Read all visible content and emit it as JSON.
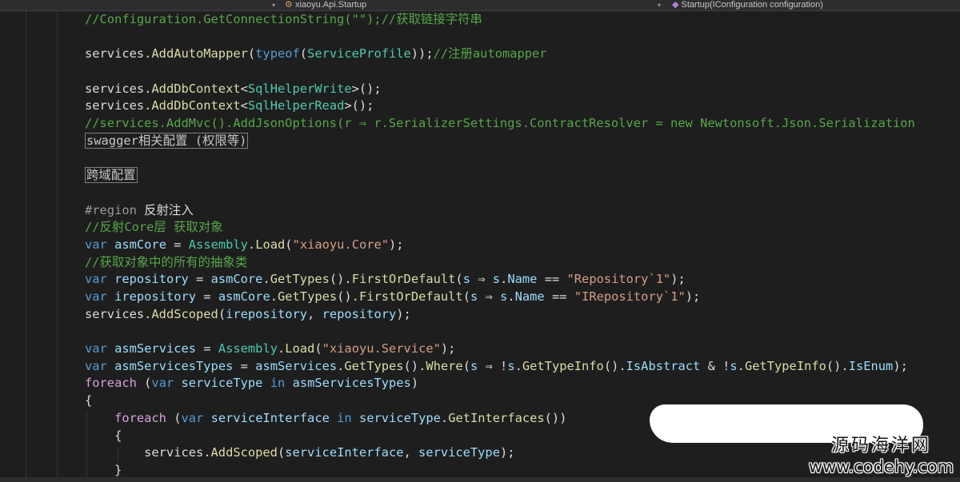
{
  "toolbar": {
    "project_dropdown": "xiaoyu.Api.Startup",
    "member_dropdown": "Startup(IConfiguration configuration)",
    "class_icon": "class-icon",
    "method_icon": "method-icon"
  },
  "code_lines": [
    [
      [
        "comment",
        "//Configuration.GetConnectionString(\"\");//获取链接字符串"
      ]
    ],
    [],
    [
      [
        "plain",
        "services."
      ],
      [
        "method",
        "AddAutoMapper"
      ],
      [
        "plain",
        "("
      ],
      [
        "keyword",
        "typeof"
      ],
      [
        "plain",
        "("
      ],
      [
        "type",
        "ServiceProfile"
      ],
      [
        "plain",
        "));"
      ],
      [
        "comment",
        "//注册automapper"
      ]
    ],
    [],
    [
      [
        "plain",
        "services."
      ],
      [
        "method",
        "AddDbContext"
      ],
      [
        "plain",
        "<"
      ],
      [
        "type",
        "SqlHelperWrite"
      ],
      [
        "plain",
        ">();"
      ]
    ],
    [
      [
        "plain",
        "services."
      ],
      [
        "method",
        "AddDbContext"
      ],
      [
        "plain",
        "<"
      ],
      [
        "type",
        "SqlHelperRead"
      ],
      [
        "plain",
        ">();"
      ]
    ],
    [
      [
        "comment",
        "//services.AddMvc().AddJsonOptions(r ⇒ r.SerializerSettings.ContractResolver = new Newtonsoft.Json.Serialization"
      ]
    ],
    [
      [
        "collapsed",
        "swagger相关配置 (权限等)"
      ]
    ],
    [],
    [
      [
        "collapsed",
        "跨域配置"
      ]
    ],
    [],
    [
      [
        "region",
        "#region "
      ],
      [
        "regionname",
        "反射注入"
      ]
    ],
    [
      [
        "comment",
        "//反射Core层 获取对象"
      ]
    ],
    [
      [
        "keyword",
        "var"
      ],
      [
        "plain",
        " "
      ],
      [
        "variable",
        "asmCore"
      ],
      [
        "plain",
        " = "
      ],
      [
        "type",
        "Assembly"
      ],
      [
        "plain",
        "."
      ],
      [
        "method",
        "Load"
      ],
      [
        "plain",
        "("
      ],
      [
        "string",
        "\"xiaoyu.Core\""
      ],
      [
        "plain",
        ");"
      ]
    ],
    [
      [
        "comment",
        "//获取对象中的所有的抽象类"
      ]
    ],
    [
      [
        "keyword",
        "var"
      ],
      [
        "plain",
        " "
      ],
      [
        "variable",
        "repository"
      ],
      [
        "plain",
        " = "
      ],
      [
        "variable",
        "asmCore"
      ],
      [
        "plain",
        "."
      ],
      [
        "method",
        "GetTypes"
      ],
      [
        "plain",
        "()."
      ],
      [
        "method",
        "FirstOrDefault"
      ],
      [
        "plain",
        "("
      ],
      [
        "variable",
        "s"
      ],
      [
        "plain",
        " ⇒ "
      ],
      [
        "variable",
        "s"
      ],
      [
        "plain",
        "."
      ],
      [
        "variable",
        "Name"
      ],
      [
        "plain",
        " == "
      ],
      [
        "string",
        "\"Repository`1\""
      ],
      [
        "plain",
        ");"
      ]
    ],
    [
      [
        "keyword",
        "var"
      ],
      [
        "plain",
        " "
      ],
      [
        "variable",
        "irepository"
      ],
      [
        "plain",
        " = "
      ],
      [
        "variable",
        "asmCore"
      ],
      [
        "plain",
        "."
      ],
      [
        "method",
        "GetTypes"
      ],
      [
        "plain",
        "()."
      ],
      [
        "method",
        "FirstOrDefault"
      ],
      [
        "plain",
        "("
      ],
      [
        "variable",
        "s"
      ],
      [
        "plain",
        " ⇒ "
      ],
      [
        "variable",
        "s"
      ],
      [
        "plain",
        "."
      ],
      [
        "variable",
        "Name"
      ],
      [
        "plain",
        " == "
      ],
      [
        "string",
        "\"IRepository`1\""
      ],
      [
        "plain",
        ");"
      ]
    ],
    [
      [
        "plain",
        "services."
      ],
      [
        "method",
        "AddScoped"
      ],
      [
        "plain",
        "("
      ],
      [
        "variable",
        "irepository"
      ],
      [
        "plain",
        ", "
      ],
      [
        "variable",
        "repository"
      ],
      [
        "plain",
        ");"
      ]
    ],
    [],
    [
      [
        "keyword",
        "var"
      ],
      [
        "plain",
        " "
      ],
      [
        "variable",
        "asmServices"
      ],
      [
        "plain",
        " = "
      ],
      [
        "type",
        "Assembly"
      ],
      [
        "plain",
        "."
      ],
      [
        "method",
        "Load"
      ],
      [
        "plain",
        "("
      ],
      [
        "string",
        "\"xiaoyu.Service\""
      ],
      [
        "plain",
        ");"
      ]
    ],
    [
      [
        "keyword",
        "var"
      ],
      [
        "plain",
        " "
      ],
      [
        "variable",
        "asmServicesTypes"
      ],
      [
        "plain",
        " = "
      ],
      [
        "variable",
        "asmServices"
      ],
      [
        "plain",
        "."
      ],
      [
        "method",
        "GetTypes"
      ],
      [
        "plain",
        "()."
      ],
      [
        "method",
        "Where"
      ],
      [
        "plain",
        "("
      ],
      [
        "variable",
        "s"
      ],
      [
        "plain",
        " ⇒ !"
      ],
      [
        "variable",
        "s"
      ],
      [
        "plain",
        "."
      ],
      [
        "method",
        "GetTypeInfo"
      ],
      [
        "plain",
        "()."
      ],
      [
        "variable",
        "IsAbstract"
      ],
      [
        "plain",
        " & !"
      ],
      [
        "variable",
        "s"
      ],
      [
        "plain",
        "."
      ],
      [
        "method",
        "GetTypeInfo"
      ],
      [
        "plain",
        "()."
      ],
      [
        "variable",
        "IsEnum"
      ],
      [
        "plain",
        ");"
      ]
    ],
    [
      [
        "control",
        "foreach"
      ],
      [
        "plain",
        " ("
      ],
      [
        "keyword",
        "var"
      ],
      [
        "plain",
        " "
      ],
      [
        "variable",
        "serviceType"
      ],
      [
        "plain",
        " "
      ],
      [
        "keyword",
        "in"
      ],
      [
        "plain",
        " "
      ],
      [
        "variable",
        "asmServicesTypes"
      ],
      [
        "plain",
        ")"
      ]
    ],
    [
      [
        "plain",
        "{"
      ]
    ],
    [
      [
        "plain",
        "    "
      ],
      [
        "control",
        "foreach"
      ],
      [
        "plain",
        " ("
      ],
      [
        "keyword",
        "var"
      ],
      [
        "plain",
        " "
      ],
      [
        "variable",
        "serviceInterface"
      ],
      [
        "plain",
        " "
      ],
      [
        "keyword",
        "in"
      ],
      [
        "plain",
        " "
      ],
      [
        "variable",
        "serviceType"
      ],
      [
        "plain",
        "."
      ],
      [
        "method",
        "GetInterfaces"
      ],
      [
        "plain",
        "())"
      ]
    ],
    [
      [
        "plain",
        "    {"
      ]
    ],
    [
      [
        "plain",
        "        services."
      ],
      [
        "method",
        "AddScoped"
      ],
      [
        "plain",
        "("
      ],
      [
        "variable",
        "serviceInterface"
      ],
      [
        "plain",
        ", "
      ],
      [
        "variable",
        "serviceType"
      ],
      [
        "plain",
        ");"
      ]
    ],
    [
      [
        "plain",
        "    }"
      ]
    ]
  ],
  "watermark": {
    "chinese": "源码海洋网",
    "url": "www.codehy.com"
  },
  "colors": {
    "background": "#1e1e1e",
    "comment": "#57a64a",
    "keyword": "#569cd6",
    "control": "#d8a0df",
    "type": "#4ec9b0",
    "method": "#dcdcaa",
    "string": "#d69d85",
    "variable": "#9cdcfe"
  }
}
